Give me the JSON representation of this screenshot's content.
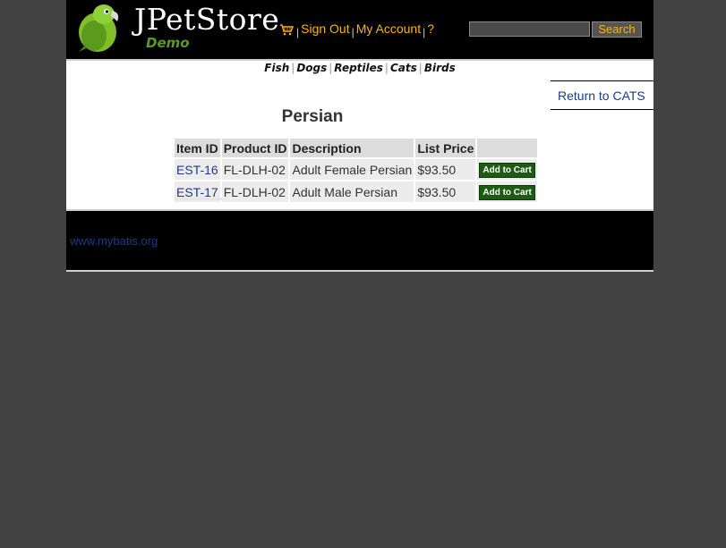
{
  "header": {
    "logo_title": "JPetStore",
    "logo_subtitle": "Demo",
    "menu": {
      "sign_out": "Sign Out",
      "my_account": "My Account",
      "help": "?",
      "separator": "|"
    },
    "search": {
      "value": "",
      "placeholder": "",
      "button_label": "Search"
    }
  },
  "quicklinks": [
    {
      "label": "Fish"
    },
    {
      "label": "Dogs"
    },
    {
      "label": "Reptiles"
    },
    {
      "label": "Cats"
    },
    {
      "label": "Birds"
    }
  ],
  "return_link": "Return to CATS",
  "product": {
    "name": "Persian",
    "columns": [
      "Item ID",
      "Product ID",
      "Description",
      "List Price",
      ""
    ],
    "items": [
      {
        "item_id": "EST-16",
        "product_id": "FL-DLH-02",
        "description": "Adult Female Persian",
        "price": "$93.50",
        "action": "Add to Cart"
      },
      {
        "item_id": "EST-17",
        "product_id": "FL-DLH-02",
        "description": "Adult Male Persian",
        "price": "$93.50",
        "action": "Add to Cart"
      }
    ]
  },
  "footer": {
    "link": "www.mybatis.org"
  },
  "colors": {
    "header_bg": "#000000",
    "page_bg": "#424242",
    "menu_link": "#ffb300",
    "link": "#1a3b8a",
    "cart_button": "#1d5a12"
  },
  "icons": [
    "parrot-logo-icon",
    "cart-icon"
  ]
}
